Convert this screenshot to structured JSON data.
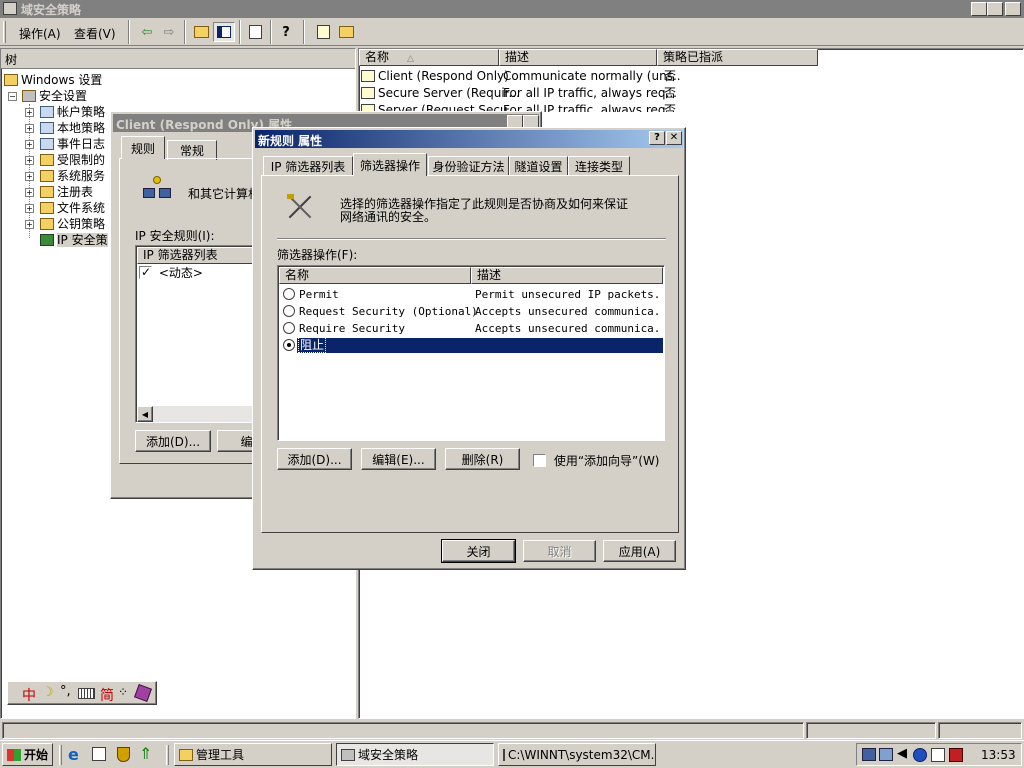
{
  "window": {
    "title": "域安全策略"
  },
  "menu": {
    "action": "操作(A)",
    "view": "查看(V)"
  },
  "tree": {
    "header": "树",
    "root": "Windows 设置",
    "security": "安全设置",
    "items": [
      "帐户策略",
      "本地策略",
      "事件日志",
      "受限制的",
      "系统服务",
      "注册表",
      "文件系统",
      "公钥策略",
      "IP 安全策"
    ]
  },
  "list": {
    "columns": [
      "名称",
      "描述",
      "策略已指派"
    ],
    "rows": [
      {
        "name": "Client (Respond Only)",
        "desc": "Communicate normally (uns...",
        "assigned": "否"
      },
      {
        "name": "Secure Server (Requir...",
        "desc": "For all IP traffic, always req...",
        "assigned": "否"
      },
      {
        "name": "Server (Request Secu...",
        "desc": "For all IP traffic, always req...",
        "assigned": "否"
      }
    ]
  },
  "client_dialog": {
    "title": "Client (Respond Only) 属性",
    "tabs": [
      "规则",
      "常规"
    ],
    "desc": "和其它计算机",
    "rules_label": "IP 安全规则(I):",
    "col_filter": "IP 筛选器列表",
    "row_dynamic": "<动态>",
    "add": "添加(D)...",
    "edit": "编辑("
  },
  "rule_dialog": {
    "title": "新规则 属性",
    "tabs": [
      "IP 筛选器列表",
      "筛选器操作",
      "身份验证方法",
      "隧道设置",
      "连接类型"
    ],
    "intro_line1": "选择的筛选器操作指定了此规则是否协商及如何来保证",
    "intro_line2": "网络通讯的安全。",
    "list_label": "筛选器操作(F):",
    "columns": [
      "名称",
      "描述"
    ],
    "rows": [
      {
        "name": "Permit",
        "desc": "Permit unsecured IP packets...",
        "selected": false
      },
      {
        "name": "Request Security (Optional)",
        "desc": "Accepts unsecured communica...",
        "selected": false
      },
      {
        "name": "Require Security",
        "desc": "Accepts unsecured communica...",
        "selected": false
      },
      {
        "name": "阻止",
        "desc": "",
        "selected": true
      }
    ],
    "add": "添加(D)...",
    "edit": "编辑(E)...",
    "remove": "删除(R)",
    "wizard": "使用“添加向导”(W)",
    "close": "关闭",
    "cancel": "取消",
    "apply": "应用(A)"
  },
  "ime": {
    "lang": "中",
    "mode": "简"
  },
  "taskbar": {
    "start": "开始",
    "items": [
      "管理工具",
      "域安全策略",
      "C:\\WINNT\\system32\\CM..."
    ],
    "clock": "13:53"
  },
  "colors": {
    "titlebar": "#0a246a",
    "inactive_title": "#808080",
    "selection": "#0a246a",
    "desktop": "#d4d0c8"
  }
}
